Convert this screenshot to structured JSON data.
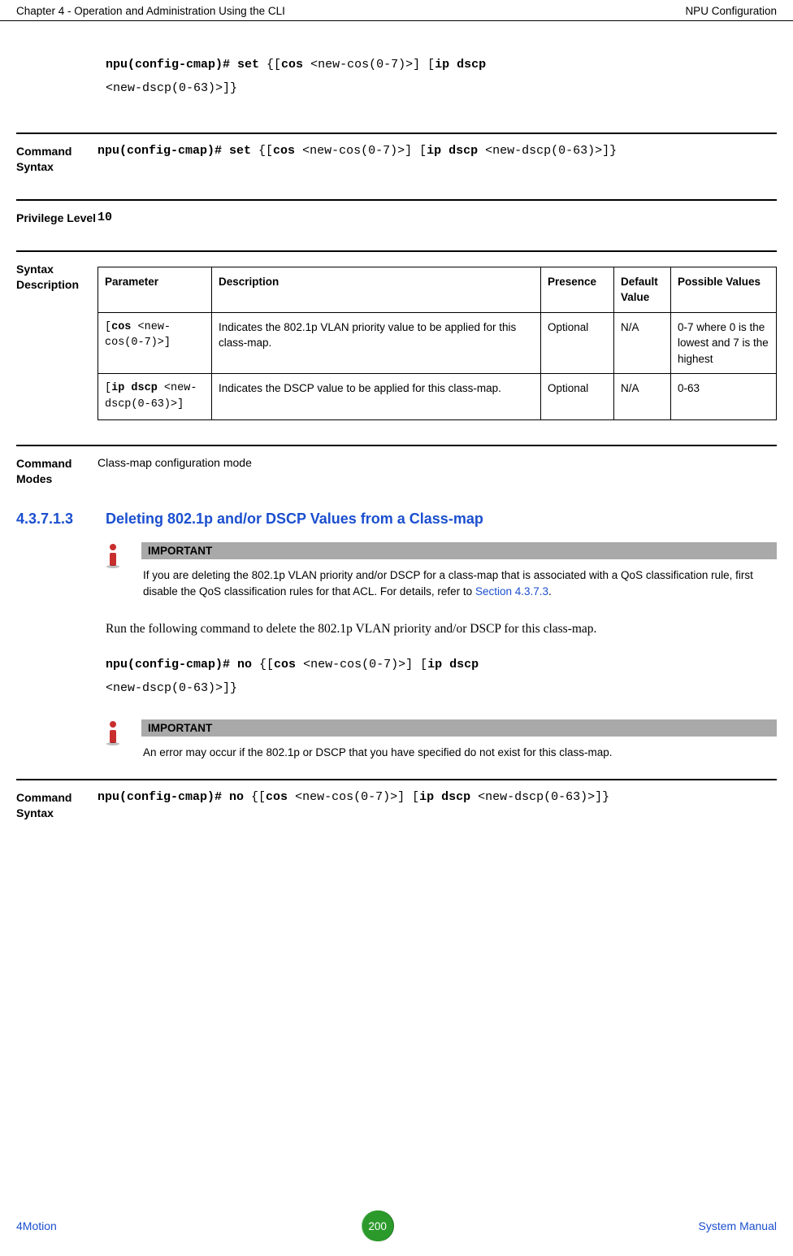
{
  "header": {
    "left": "Chapter 4 - Operation and Administration Using the CLI",
    "right": "NPU Configuration"
  },
  "cmd_intro": {
    "prefix": "npu(config-cmap)# set",
    "body1": " {[",
    "cos": "cos",
    "body2": " <new-cos(0-7)>] [",
    "ipdscp": "ip dscp",
    "body3": "",
    "line2": "<new-dscp(0-63)>]}"
  },
  "command_syntax": {
    "label": "Command Syntax",
    "prefix": "npu(config-cmap)# set",
    "body1": " {[",
    "cos": "cos",
    "body2": " <new-cos(0-7)>] [",
    "ipdscp": "ip dscp",
    "body3": " <new-dscp(0-63)>]}"
  },
  "privilege": {
    "label": "Privilege Level",
    "value": "10"
  },
  "syntax_desc": {
    "label": "Syntax Description",
    "headers": {
      "param": "Parameter",
      "desc": "Description",
      "presence": "Presence",
      "default": "Default Value",
      "possible": "Possible Values"
    },
    "rows": [
      {
        "param_b": "cos",
        "param_pre": "[",
        "param_post": " <new-cos(0-7)>]",
        "desc": "Indicates the 802.1p VLAN priority value to be applied for this class-map.",
        "presence": "Optional",
        "default": "N/A",
        "possible": "0-7 where 0 is the lowest and 7 is the highest"
      },
      {
        "param_b": "ip dscp",
        "param_pre": "[",
        "param_post": " <new-dscp(0-63)>]",
        "desc": "Indicates the DSCP value to be applied for this class-map.",
        "presence": "Optional",
        "default": "N/A",
        "possible": "0-63"
      }
    ]
  },
  "command_modes": {
    "label": "Command Modes",
    "value": "Class-map configuration mode"
  },
  "section": {
    "num": "4.3.7.1.3",
    "title": "Deleting 802.1p and/or DSCP Values from a Class-map"
  },
  "important1": {
    "head": "IMPORTANT",
    "text": "If you are deleting the 802.1p VLAN priority and/or DSCP for a class-map that is associated with a QoS classification rule, first disable the QoS classification rules for that ACL. For details, refer to ",
    "link": "Section 4.3.7.3",
    "after": "."
  },
  "serif_para": "Run the following command to delete the 802.1p VLAN priority and/or DSCP for this class-map.",
  "cmd_no": {
    "prefix": "npu(config-cmap)# no",
    "body1": " {[",
    "cos": "cos",
    "body2": " <new-cos(0-7)>] [",
    "ipdscp": "ip dscp",
    "body3": "",
    "line2": "<new-dscp(0-63)>]}"
  },
  "important2": {
    "head": "IMPORTANT",
    "text": "An error may occur if the 802.1p or DSCP that you have specified do not exist for this class-map."
  },
  "command_syntax2": {
    "label": "Command Syntax",
    "prefix": "npu(config-cmap)# no",
    "body1": " {[",
    "cos": "cos",
    "body2": " <new-cos(0-7)>] [",
    "ipdscp": "ip dscp",
    "body3": " <new-dscp(0-63)>]}"
  },
  "footer": {
    "left": "4Motion",
    "page": "200",
    "right": "System Manual"
  }
}
